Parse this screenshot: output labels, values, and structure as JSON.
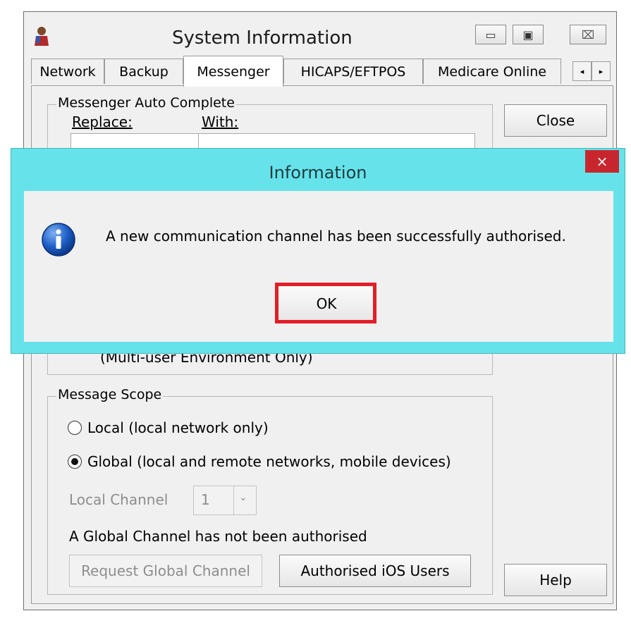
{
  "window": {
    "title": "System Information",
    "close_glyph": "⌧",
    "maximize_glyph": "▣",
    "minimize_glyph": "▭",
    "app_icon": "user-icon"
  },
  "tabs": [
    {
      "label": "Network"
    },
    {
      "label": "Backup"
    },
    {
      "label": "Messenger"
    },
    {
      "label": "HICAPS/EFTPOS"
    },
    {
      "label": "Medicare Online"
    }
  ],
  "tab_scroll": {
    "left": "◂",
    "right": "▸"
  },
  "auto_complete": {
    "group_label": "Messenger Auto Complete",
    "col_replace": "Replace:",
    "col_with": "With:",
    "footnote": "(Multi-user Environment Only)"
  },
  "buttons": {
    "close": "Close",
    "help": "Help"
  },
  "message_scope": {
    "group_label": "Message Scope",
    "local_option": "Local (local network only)",
    "global_option": "Global (local and remote networks, mobile devices)",
    "selected": "global",
    "local_channel_label": "Local Channel",
    "local_channel_value": "1",
    "status_text": "A Global Channel has not been authorised",
    "request_button": "Request Global Channel",
    "ios_button": "Authorised iOS Users"
  },
  "dialog": {
    "title": "Information",
    "close_glyph": "×",
    "message": "A new communication channel has been successfully authorised.",
    "ok_label": "OK",
    "icon": "info-icon",
    "accent_color": "#66e3ea",
    "highlight_color": "#e21e28"
  }
}
